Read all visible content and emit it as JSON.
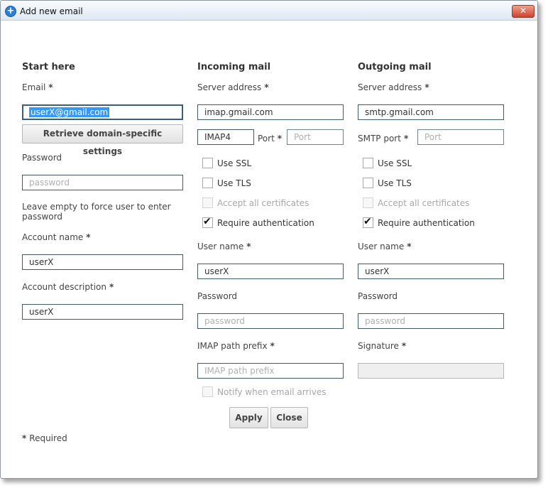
{
  "window": {
    "title": "Add new email",
    "close_glyph": "✕"
  },
  "start": {
    "heading": "Start here",
    "email_label": "Email",
    "email_value": "userX@gmail.com",
    "retrieve_button": "Retrieve domain-specific settings",
    "password_label": "Password",
    "password_placeholder": "password",
    "password_hint": "Leave empty to force user to enter password",
    "account_name_label": "Account name",
    "account_name_value": "userX",
    "account_desc_label": "Account description",
    "account_desc_value": "userX"
  },
  "incoming": {
    "heading": "Incoming mail",
    "server_label": "Server address",
    "server_value": "imap.gmail.com",
    "protocol_value": "IMAP4",
    "port_label": "Port",
    "port_placeholder": "Port",
    "ssl_label": "Use SSL",
    "tls_label": "Use TLS",
    "accept_certs_label": "Accept all certificates",
    "require_auth_label": "Require authentication",
    "username_label": "User name",
    "username_value": "userX",
    "password_label": "Password",
    "password_placeholder": "password",
    "imap_prefix_label": "IMAP path prefix",
    "imap_prefix_placeholder": "IMAP path prefix",
    "notify_label": "Notify when email arrives"
  },
  "outgoing": {
    "heading": "Outgoing mail",
    "server_label": "Server address",
    "server_value": "smtp.gmail.com",
    "smtp_port_label": "SMTP port",
    "port_placeholder": "Port",
    "ssl_label": "Use SSL",
    "tls_label": "Use TLS",
    "accept_certs_label": "Accept all certificates",
    "require_auth_label": "Require authentication",
    "username_label": "User name",
    "username_value": "userX",
    "password_label": "Password",
    "password_placeholder": "password",
    "signature_label": "Signature",
    "signature_value": ""
  },
  "buttons": {
    "apply": "Apply",
    "close": "Close"
  },
  "footer": {
    "required_mark": "*",
    "required_text": "Required"
  },
  "required_mark": "*",
  "checkbox_states": {
    "incoming_ssl": false,
    "incoming_tls": false,
    "incoming_accept_certs": false,
    "incoming_require_auth": true,
    "incoming_notify": false,
    "outgoing_ssl": false,
    "outgoing_tls": false,
    "outgoing_accept_certs": false,
    "outgoing_require_auth": true
  },
  "colors": {
    "accent": "#2c7ed6",
    "selection": "#3399ff",
    "input_border": "#3f5a6d"
  }
}
